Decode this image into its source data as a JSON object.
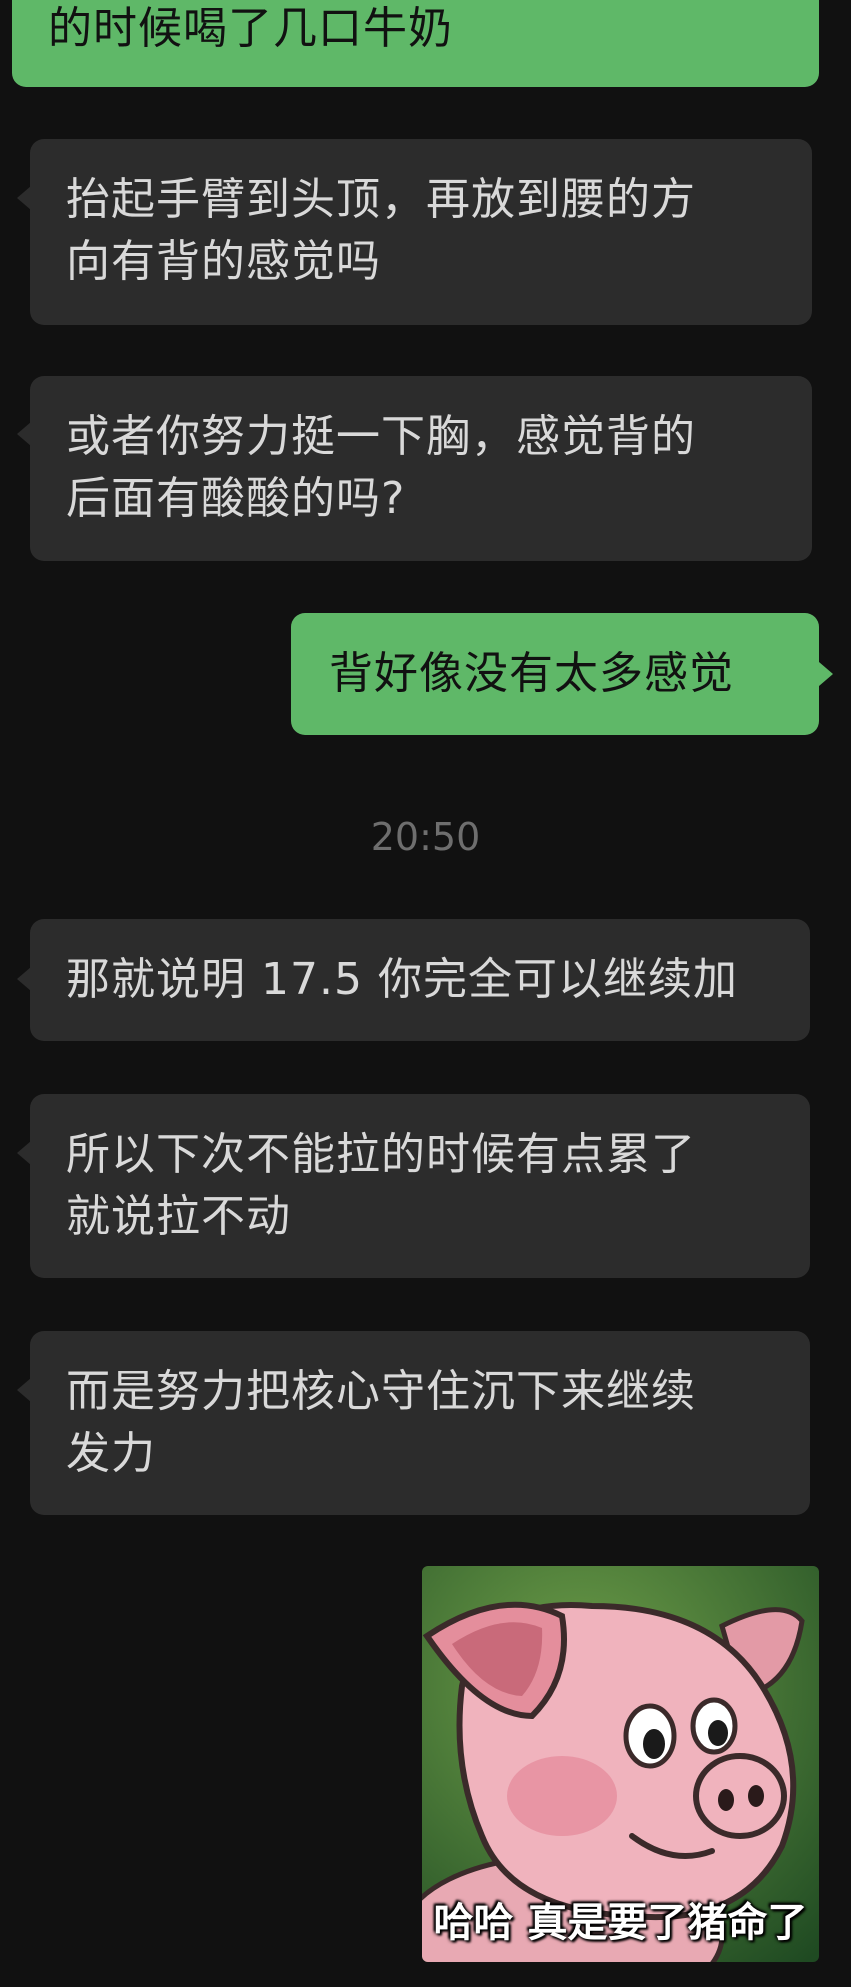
{
  "messages": [
    {
      "side": "out",
      "lines": [
        "的时候喝了几口牛奶"
      ]
    },
    {
      "side": "in",
      "lines": [
        "抬起手臂到头顶，再放到腰的方",
        "向有背的感觉吗"
      ]
    },
    {
      "side": "in",
      "lines": [
        "或者你努力挺一下胸，感觉背的",
        "后面有酸酸的吗?"
      ]
    },
    {
      "side": "out",
      "lines": [
        "背好像没有太多感觉"
      ]
    },
    {
      "side": "in",
      "lines": [
        "那就说明 17.5 你完全可以继续加"
      ]
    },
    {
      "side": "in",
      "lines": [
        "所以下次不能拉的时候有点累了",
        "就说拉不动"
      ]
    },
    {
      "side": "in",
      "lines": [
        "而是努力把核心守住沉下来继续",
        "发力"
      ]
    }
  ],
  "timestamp": "20:50",
  "sticker": {
    "caption": "哈哈 真是要了猪命了",
    "icon": "pig-sticker"
  },
  "colors": {
    "background": "#111111",
    "incoming_bubble": "#2c2c2c",
    "outgoing_bubble": "#5fb868",
    "incoming_text": "#d9d9d9",
    "outgoing_text": "#111111",
    "timestamp_text": "#6e6e6e"
  }
}
